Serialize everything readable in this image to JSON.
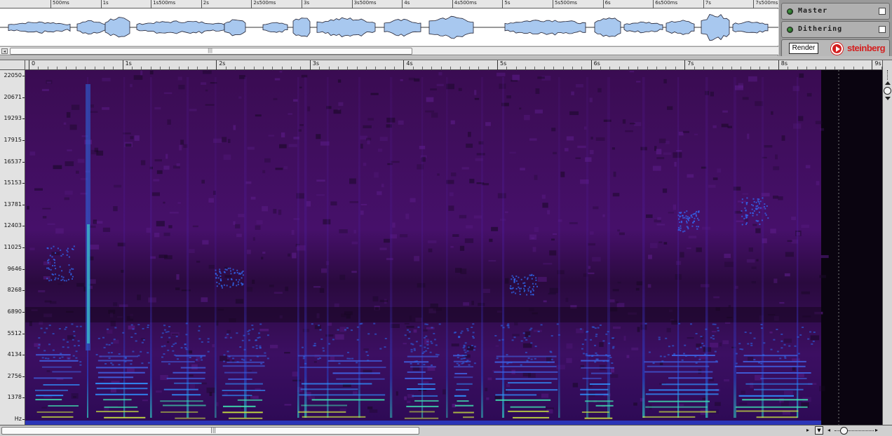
{
  "overview": {
    "ruler_labels": [
      "500ms",
      "1s",
      "1s500ms",
      "2s",
      "2s500ms",
      "3s",
      "3s500ms",
      "4s",
      "4s500ms",
      "5s",
      "5s500ms",
      "6s",
      "6s500ms",
      "7s",
      "7s500ms"
    ]
  },
  "panel": {
    "master_label": "Master",
    "dithering_label": "Dithering",
    "render_label": "Render",
    "logo_text": "steinberg"
  },
  "timeline": {
    "labels": [
      "0",
      "1s",
      "2s",
      "3s",
      "4s",
      "5s",
      "6s",
      "7s",
      "8s",
      "9s"
    ]
  },
  "frequency_axis": {
    "labels": [
      "22050",
      "20671",
      "19293",
      "17915",
      "16537",
      "15153",
      "13781",
      "12403",
      "11025",
      "9646",
      "8268",
      "6890",
      "5512",
      "4134",
      "2756",
      "1378",
      "Hz"
    ]
  },
  "colors": {
    "spectro_bg": "#120619",
    "waveform_fill": "#a8c8ef",
    "accent_red": "#d42020"
  },
  "icons": [
    "led-icon",
    "checkbox-icon",
    "steinberg-logo-icon",
    "zoom-in-icon",
    "zoom-out-icon",
    "scroll-left-icon",
    "scroll-right-icon"
  ]
}
